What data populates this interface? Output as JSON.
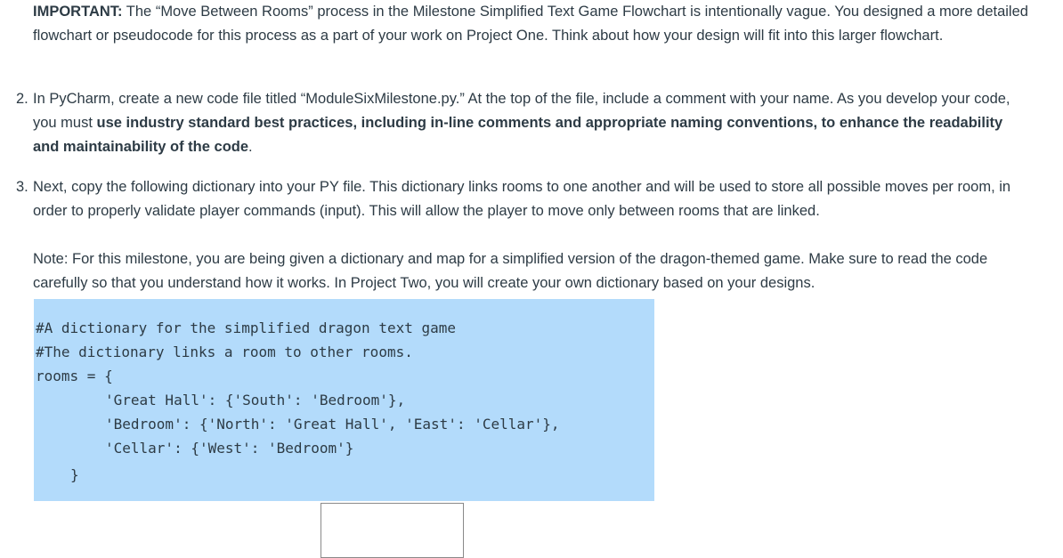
{
  "important": {
    "label": "IMPORTANT:",
    "text": " The “Move Between Rooms” process in the Milestone Simplified Text Game Flowchart is intentionally vague. You designed a more detailed flowchart or pseudocode for this process as a part of your work on Project One. Think about how your design will fit into this larger flowchart."
  },
  "steps": [
    {
      "number": "2.",
      "text_before": "In PyCharm, create a new code file titled “ModuleSixMilestone.py.” At the top of the file, include a comment with your name. As you develop your code, you must ",
      "text_bold": "use industry standard best practices, including in-line comments and appropriate naming conventions, to enhance the readability and maintainability of the code",
      "text_after": "."
    },
    {
      "number": "3.",
      "text": "Next, copy the following dictionary into your PY file. This dictionary links rooms to one another and will be used to store all possible moves per room, in order to properly validate player commands (input). This will allow the player to move only between rooms that are linked."
    }
  ],
  "note": "Note: For this milestone, you are being given a dictionary and map for a simplified version of the dragon-themed game. Make sure to read the code carefully so that you understand how it works. In Project Two, you will create your own dictionary based on your designs.",
  "code_lines": [
    "#A dictionary for the simplified dragon text game",
    "#The dictionary links a room to other rooms.",
    "rooms = {",
    "'Great Hall': {'South': 'Bedroom'},",
    "'Bedroom': {'North': 'Great Hall', 'East': 'Cellar'},",
    "'Cellar': {'West': 'Bedroom'}",
    "}"
  ],
  "colors": {
    "text": "#2d3b45",
    "code_background": "#b3dbfb"
  }
}
